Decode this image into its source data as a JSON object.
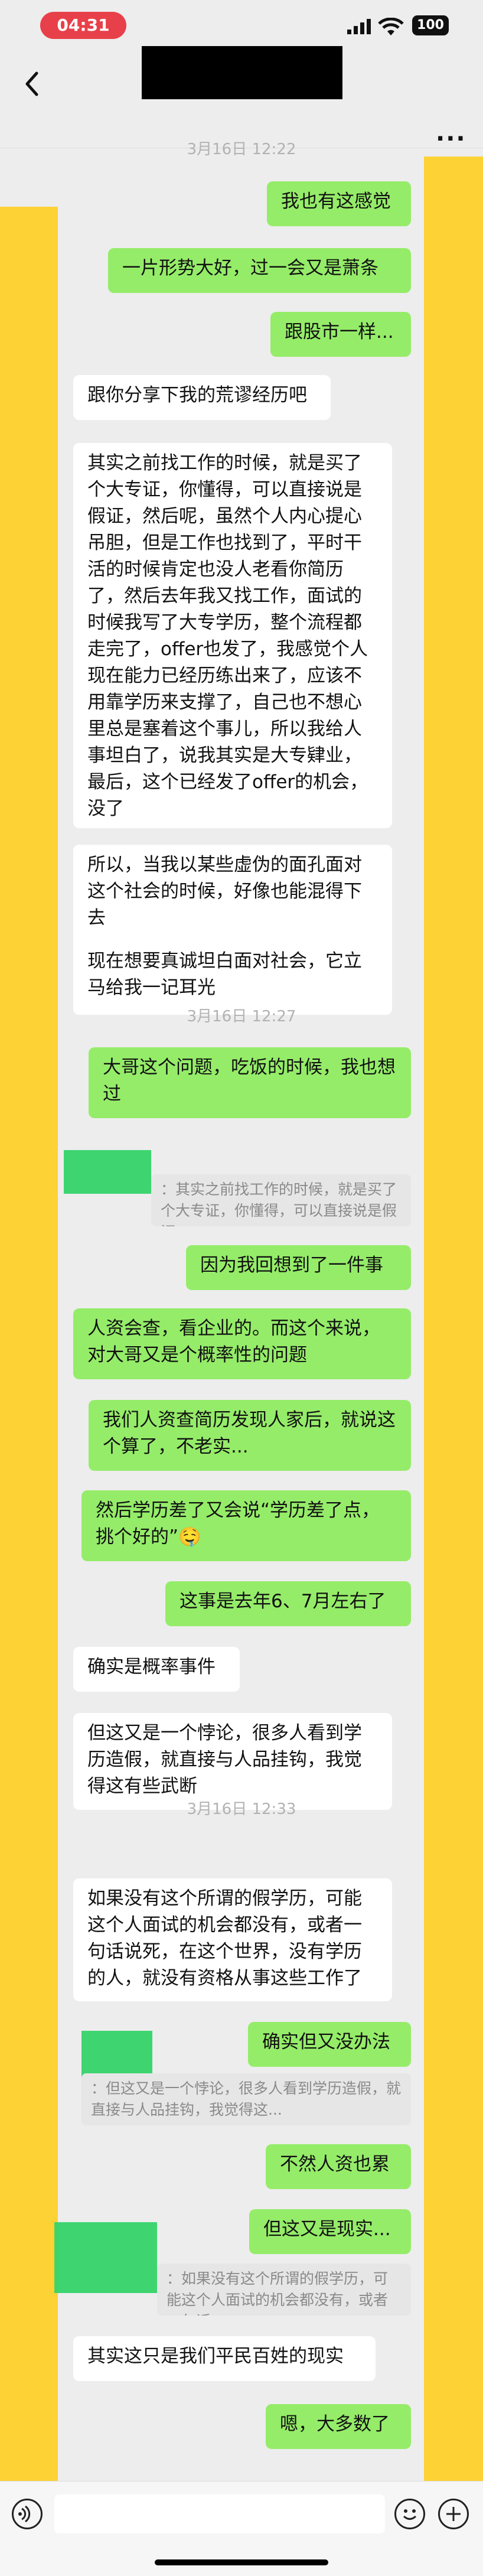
{
  "status": {
    "time": "04:31",
    "battery": "100"
  },
  "nav": {
    "back": "‹",
    "more": "···"
  },
  "timestamps": [
    "3月16日 12:22",
    "3月16日 12:27",
    "3月16日 12:33"
  ],
  "messages": {
    "m1": "我也有这感觉",
    "m2": "一片形势大好，过一会又是萧条",
    "m3": "跟股市一样...",
    "m4": "跟你分享下我的荒谬经历吧",
    "m5": "其实之前找工作的时候，就是买了个大专证，你懂得，可以直接说是假证，然后呢，虽然个人内心提心吊胆，但是工作也找到了，平时干活的时候肯定也没人老看你简历了，然后去年我又找工作，面试的时候我写了大专学历，整个流程都走完了，offer也发了，我感觉个人现在能力已经历练出来了，应该不用靠学历来支撑了，自己也不想心里总是塞着这个事儿，所以我给人事坦白了，说我其实是大专肄业，最后，这个已经发了offer的机会，没了",
    "m6a": "所以，当我以某些虚伪的面孔面对这个社会的时候，好像也能混得下去",
    "m6b": "现在想要真诚坦白面对社会，它立马给我一记耳光",
    "m7": "大哥这个问题，吃饭的时候，我也想过",
    "q1": "：其实之前找工作的时候，就是买了个大专证，你懂得，可以直接说是假证...",
    "m8": "因为我回想到了一件事",
    "m9": "人资会查，看企业的。而这个来说，对大哥又是个概率性的问题",
    "m10": "我们人资查简历发现人家后，就说这个算了，不老实...",
    "m11": "然后学历差了又会说“学历差了点，挑个好的”🤤",
    "m12": "这事是去年6、7月左右了",
    "m13": "确实是概率事件",
    "m14": "但这又是一个悖论，很多人看到学历造假，就直接与人品挂钩，我觉得这有些武断",
    "m15": "如果没有这个所谓的假学历，可能这个人面试的机会都没有，或者一句话说死，在这个世界，没有学历的人，就没有资格从事这些工作了",
    "m16": "确实但又没办法",
    "q2": "：但这又是一个悖论，很多人看到学历造假，就直接与人品挂钩，我觉得这...",
    "m17": "不然人资也累",
    "m18": "但这又是现实...",
    "q3": "：如果没有这个所谓的假学历，可能这个人面试的机会都没有，或者一句话...",
    "m19": "其实这只是我们平民百姓的现实",
    "m20": "嗯，大多数了"
  }
}
